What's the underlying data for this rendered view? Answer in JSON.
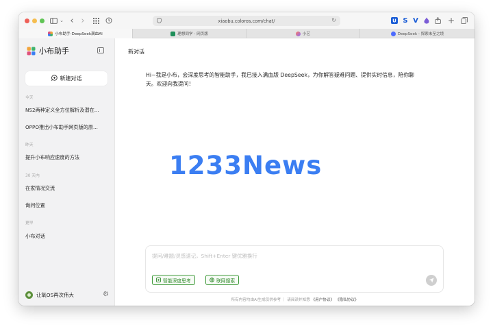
{
  "browser": {
    "url": "xiaobu.coloros.com/chat/",
    "tabs": [
      {
        "label": "小布助手-DeepSeek满血AI",
        "active": true
      },
      {
        "label": "理想同学 - 网页版",
        "active": false
      },
      {
        "label": "小艺",
        "active": false
      },
      {
        "label": "DeepSeek - 探索未至之境",
        "active": false
      }
    ],
    "traffic_lights": [
      "#ee5f57",
      "#f5bd4f",
      "#5fc454"
    ]
  },
  "sidebar": {
    "brand": "小布助手",
    "new_chat_label": "新建对话",
    "groups": [
      {
        "label": "今天",
        "items": [
          "NS2两种定义全方位解析及潜在...",
          "OPPO推出小布助手网页版的原..."
        ]
      },
      {
        "label": "昨天",
        "items": [
          "提升小布响应速度的方法"
        ]
      },
      {
        "label": "30 天内",
        "items": [
          "在家情况交流",
          "询问位置"
        ]
      },
      {
        "label": "更早",
        "items": [
          "小布对话"
        ]
      }
    ],
    "user_name": "让氧OS再次伟大"
  },
  "main": {
    "title": "新对话",
    "greeting": "Hi~我是小布，会深度思考的智能助手，我已接入满血版 DeepSeek，为你解答疑难问题、提供实时信息，陪你聊天。欢迎向我提问！",
    "watermark": "1233News",
    "input_placeholder": "提问/难题/灵感速记，Shift+Enter 键优雅换行",
    "deep_think_label": "智能深度思考",
    "web_search_label": "联网搜索",
    "footer_prefix": "所有内容均由AI生成仅供参考 ｜ 请阅读并知悉",
    "footer_user_agreement": "《用户协议》",
    "footer_privacy": "《隐私协议》"
  },
  "colors": {
    "accent_green": "#3f9a3a",
    "watermark_blue": "#3b7ef2",
    "sidebar_bg": "#f2f2f3"
  }
}
